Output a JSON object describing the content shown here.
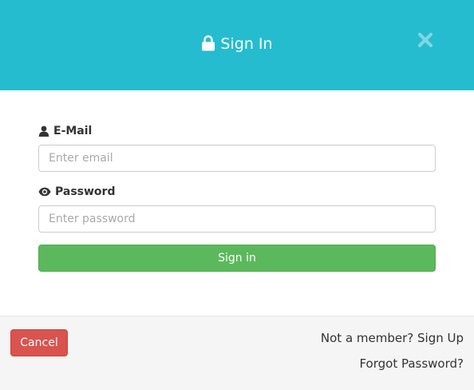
{
  "header": {
    "title": "Sign In",
    "lock_icon": "lock-icon",
    "close_icon": "close-icon",
    "background_color": "#25bccf"
  },
  "form": {
    "email": {
      "label": "E-Mail",
      "icon": "user-icon",
      "placeholder": "Enter email",
      "value": ""
    },
    "password": {
      "label": "Password",
      "icon": "eye-icon",
      "placeholder": "Enter password",
      "value": ""
    },
    "submit_label": "Sign in",
    "submit_color": "#5cb85c"
  },
  "footer": {
    "cancel_label": "Cancel",
    "cancel_color": "#d9534f",
    "signup_link": "Not a member? Sign Up",
    "forgot_link": "Forgot Password?"
  }
}
